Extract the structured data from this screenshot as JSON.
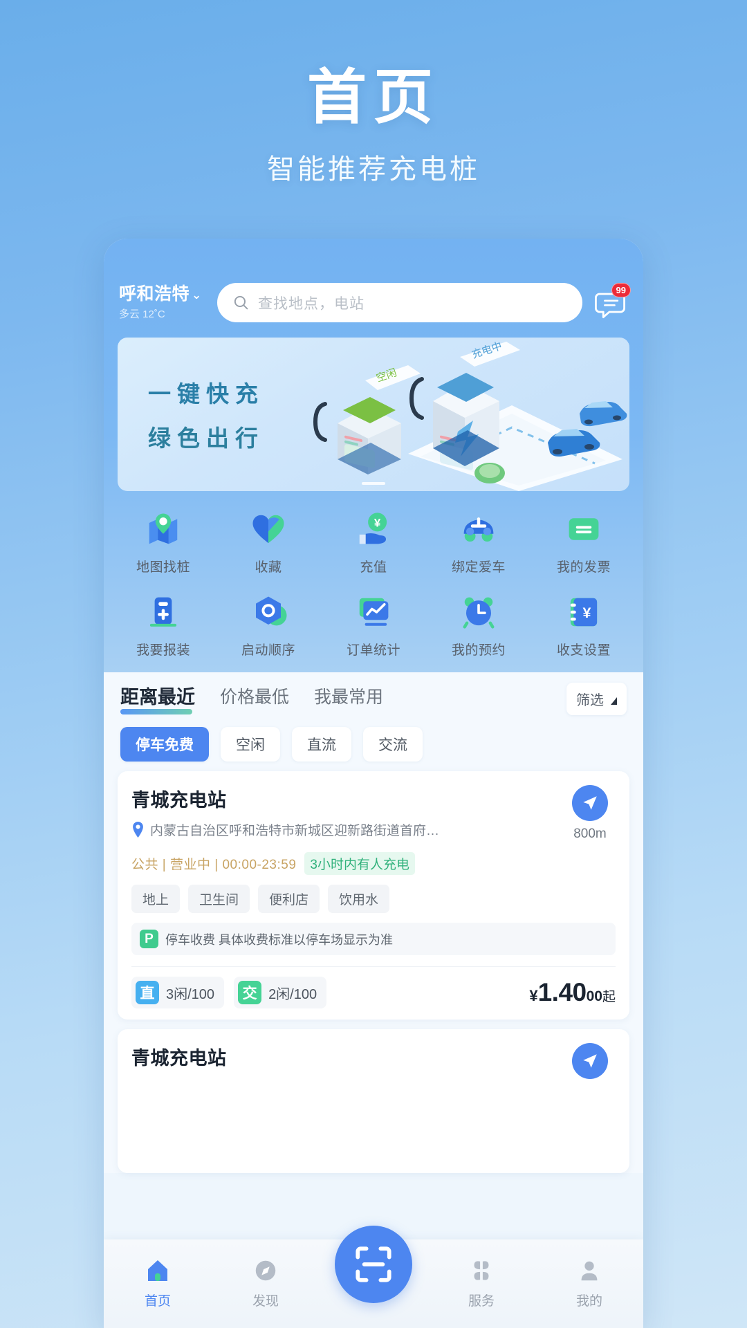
{
  "promo": {
    "title": "首页",
    "subtitle": "智能推荐充电桩"
  },
  "header": {
    "city": "呼和浩特",
    "chevron": "⌄",
    "weather": "多云 12˚C",
    "search_placeholder": "查找地点，电站",
    "message_badge": "99"
  },
  "banner": {
    "line1": "一键快充",
    "line2": "绿色出行",
    "label_idle": "空闲",
    "label_charging": "充电中"
  },
  "grid": [
    {
      "label": "地图找桩",
      "icon": "map-pin-icon"
    },
    {
      "label": "收藏",
      "icon": "heart-icon"
    },
    {
      "label": "充值",
      "icon": "hand-yuan-icon"
    },
    {
      "label": "绑定爱车",
      "icon": "car-icon"
    },
    {
      "label": "我的发票",
      "icon": "invoice-icon"
    },
    {
      "label": "我要报装",
      "icon": "charger-plus-icon"
    },
    {
      "label": "启动顺序",
      "icon": "hex-gear-icon"
    },
    {
      "label": "订单统计",
      "icon": "chart-monitor-icon"
    },
    {
      "label": "我的预约",
      "icon": "alarm-clock-icon"
    },
    {
      "label": "收支设置",
      "icon": "book-yuan-icon"
    }
  ],
  "sort_tabs": [
    {
      "label": "距离最近",
      "active": true
    },
    {
      "label": "价格最低",
      "active": false
    },
    {
      "label": "我最常用",
      "active": false
    }
  ],
  "filter_button": {
    "label": "筛选"
  },
  "chips": [
    {
      "label": "停车免费",
      "active": true
    },
    {
      "label": "空闲",
      "active": false
    },
    {
      "label": "直流",
      "active": false
    },
    {
      "label": "交流",
      "active": false
    }
  ],
  "stations": [
    {
      "name": "青城充电站",
      "address": "内蒙古自治区呼和浩特市新城区迎新路街道首府…",
      "distance": "800m",
      "status": "公共 | 营业中 | 00:00-23:59",
      "live": "3小时内有人充电",
      "tags": [
        "地上",
        "卫生间",
        "便利店",
        "饮用水"
      ],
      "parking_badge": "P",
      "parking_text": "停车收费 具体收费标准以停车场显示为准",
      "connectors": [
        {
          "badge": "直",
          "text": "3闲/100",
          "type": "dc"
        },
        {
          "badge": "交",
          "text": "2闲/100",
          "type": "ac"
        }
      ],
      "price_symbol": "¥",
      "price_main": "1.40",
      "price_cents": "00",
      "price_suffix": "起"
    },
    {
      "name": "青城充电站"
    }
  ],
  "tabbar": [
    {
      "label": "首页",
      "icon": "home-icon",
      "active": true
    },
    {
      "label": "发现",
      "icon": "compass-icon",
      "active": false
    },
    {
      "label": "服务",
      "icon": "grid-flower-icon",
      "active": false
    },
    {
      "label": "我的",
      "icon": "person-icon",
      "active": false
    }
  ],
  "scan_button": {
    "icon": "scan-qr-icon"
  },
  "colors": {
    "accent": "#4d86f0",
    "green": "#45d395",
    "badge_red": "#ec2b39",
    "gold": "#c8a464",
    "banner_text": "#2a7fa8"
  }
}
